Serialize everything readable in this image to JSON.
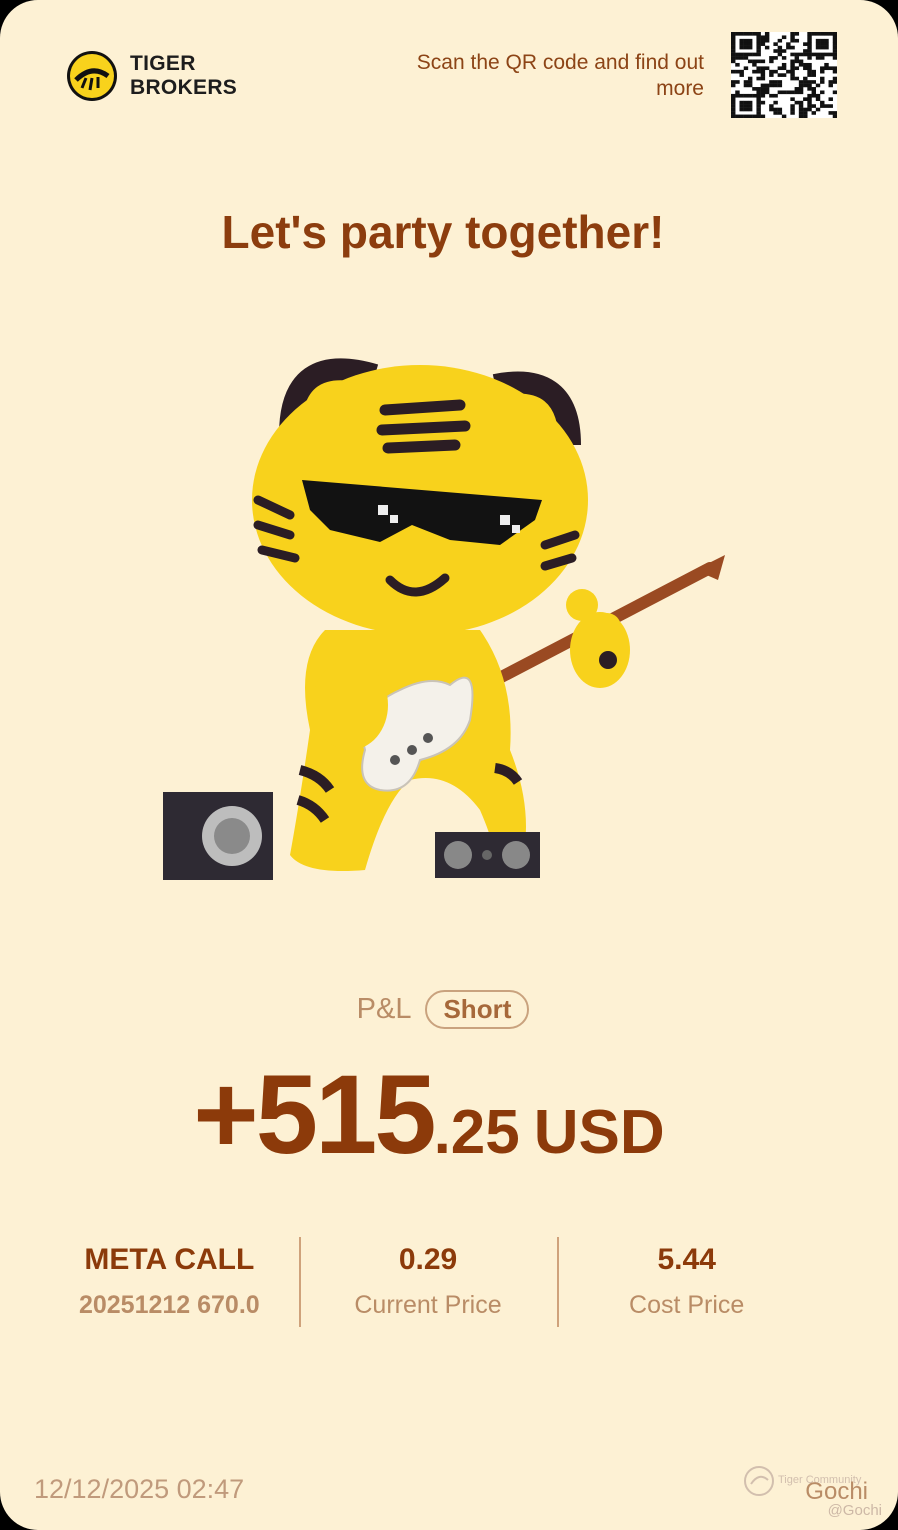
{
  "brand": {
    "line1": "TIGER",
    "line2": "BROKERS"
  },
  "scan_prompt": "Scan the QR code and find out more",
  "headline": "Let's party together!",
  "pnl": {
    "label": "P&L",
    "position": "Short",
    "amount_integer": "+515",
    "amount_decimal": ".25",
    "currency": "USD"
  },
  "stats": {
    "contract_symbol": "META CALL",
    "contract_detail": "20251212 670.0",
    "current_price_value": "0.29",
    "current_price_label": "Current Price",
    "cost_price_value": "5.44",
    "cost_price_label": "Cost Price"
  },
  "timestamp": "12/12/2025 02:47",
  "watermark": {
    "community": "Tiger Community",
    "user": "Gochi",
    "handle": "@Gochi"
  },
  "colors": {
    "background": "#fdf1d4",
    "accent_brown": "#8c3a0a",
    "muted_brown": "#b98c66",
    "mascot_yellow": "#f8d21c"
  },
  "icons": [
    "tiger-logo-icon",
    "qr-code",
    "tiger-guitar-mascot",
    "speaker-icon",
    "tiger-community-icon"
  ]
}
